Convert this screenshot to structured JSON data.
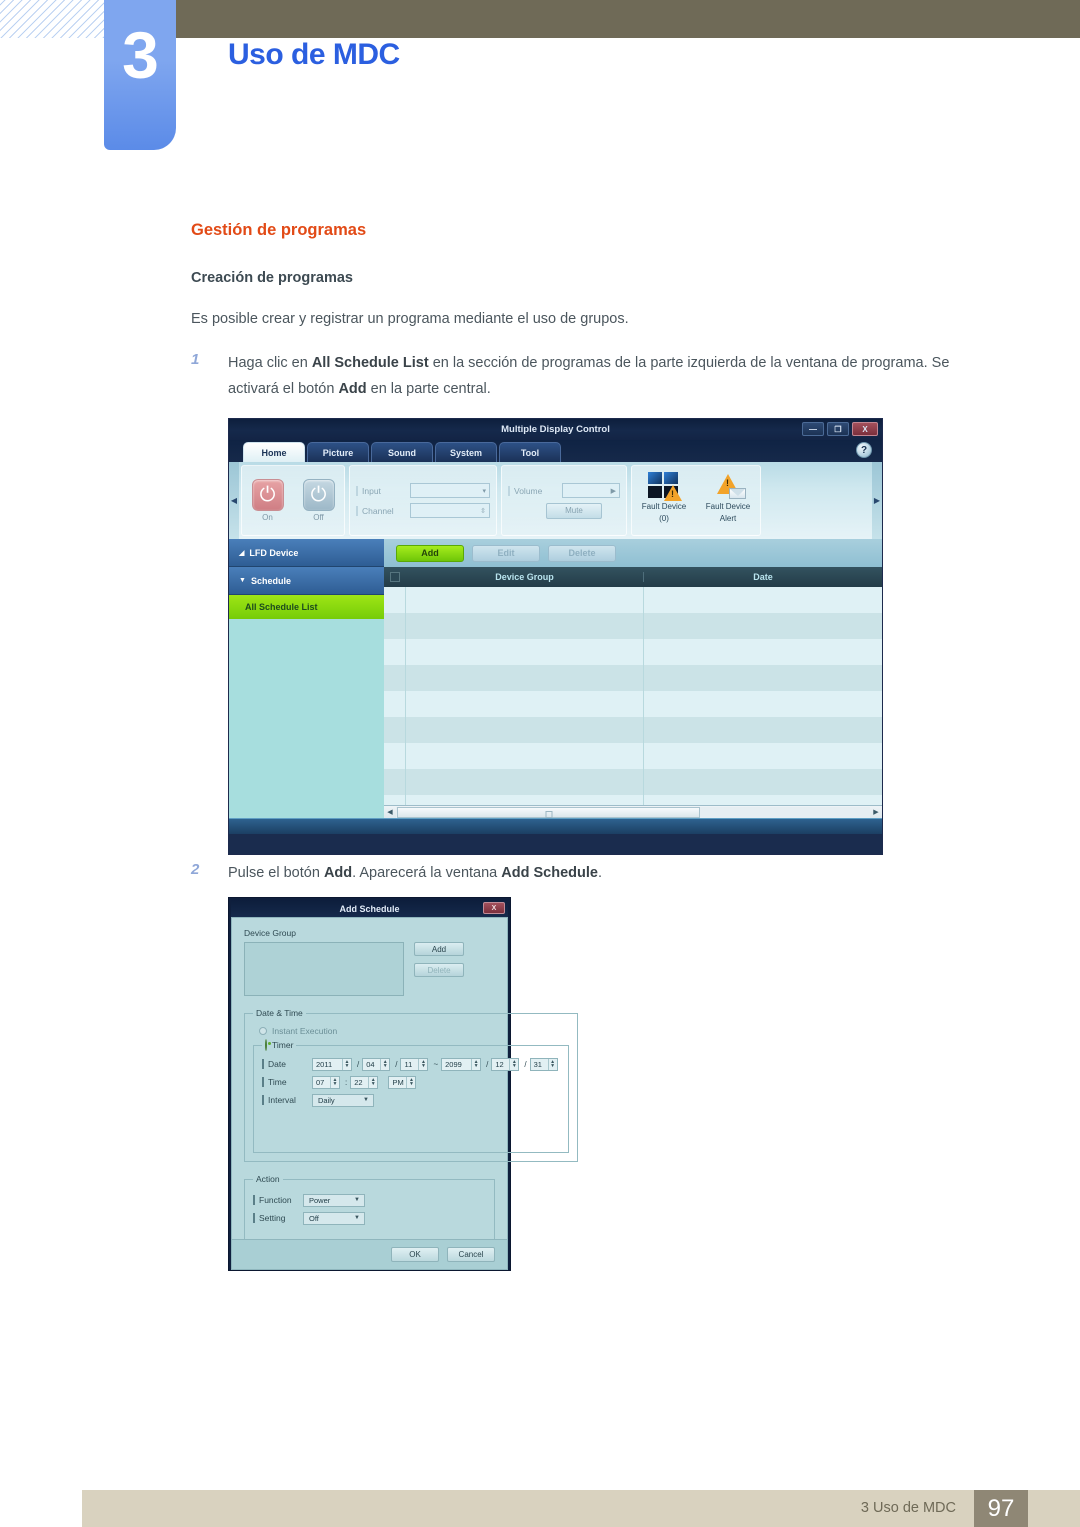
{
  "chapter": {
    "number": "3",
    "title": "Uso de MDC"
  },
  "section": {
    "title": "Gestión de programas",
    "subtitle": "Creación de programas",
    "intro": "Es posible crear y registrar un programa mediante el uso de grupos.",
    "steps": [
      {
        "num": "1",
        "text_1": "Haga clic en ",
        "bold_1": "All Schedule List",
        "text_2": " en la sección de programas de la parte izquierda de la ventana de programa. Se activará el botón ",
        "bold_2": "Add",
        "text_3": " en la parte central."
      },
      {
        "num": "2",
        "text_1": "Pulse el botón ",
        "bold_1": "Add",
        "text_2": ". Aparecerá la ventana ",
        "bold_2": "Add Schedule",
        "text_3": "."
      }
    ]
  },
  "mdc_window": {
    "title": "Multiple Display Control",
    "window_buttons": {
      "minimize": "—",
      "maximize": "❐",
      "close": "X"
    },
    "help_label": "?",
    "tabs": [
      {
        "label": "Home",
        "active": true
      },
      {
        "label": "Picture",
        "active": false
      },
      {
        "label": "Sound",
        "active": false
      },
      {
        "label": "System",
        "active": false
      },
      {
        "label": "Tool",
        "active": false
      }
    ],
    "ribbon": {
      "power": {
        "on_label": "On",
        "off_label": "Off",
        "icon": "power-icon"
      },
      "input_label": "Input",
      "channel_label": "Channel",
      "volume_label": "Volume",
      "mute_label": "Mute",
      "fault_device_label": "Fault Device",
      "fault_device_count": "(0)",
      "fault_alert_label_1": "Fault Device",
      "fault_alert_label_2": "Alert"
    },
    "sidebar": [
      {
        "label": "LFD Device",
        "caret": "◢",
        "type": "group"
      },
      {
        "label": "Schedule",
        "caret": "▼",
        "type": "group"
      },
      {
        "label": "All Schedule List",
        "type": "selected"
      }
    ],
    "buttons": [
      {
        "label": "Add",
        "state": "enabled"
      },
      {
        "label": "Edit",
        "state": "disabled"
      },
      {
        "label": "Delete",
        "state": "disabled"
      }
    ],
    "table": {
      "columns": [
        "",
        "Device Group",
        "Date"
      ],
      "rows": []
    },
    "colors": {
      "accent_green": "#76cc08",
      "title_bar": "#132445",
      "sidebar_blue": "#2e5d94",
      "table_row_light": "#dff1f5",
      "table_row_dark": "#cbe3e7"
    }
  },
  "add_schedule_dialog": {
    "title": "Add Schedule",
    "close_label": "X",
    "device_group": {
      "label": "Device Group",
      "add_label": "Add",
      "delete_label": "Delete"
    },
    "date_time": {
      "legend": "Date & Time",
      "instant_execution": "Instant Execution",
      "timer": "Timer",
      "date_label": "Date",
      "date_start": {
        "year": "2011",
        "month": "04",
        "day": "11"
      },
      "range_sep": "~",
      "date_end": {
        "year": "2099",
        "month": "12",
        "day": "31"
      },
      "time_label": "Time",
      "time": {
        "hour": "07",
        "minute": "22",
        "ampm": "PM"
      },
      "time_sep": ":",
      "interval_label": "Interval",
      "interval_value": "Daily"
    },
    "action": {
      "legend": "Action",
      "function_label": "Function",
      "function_value": "Power",
      "setting_label": "Setting",
      "setting_value": "Off"
    },
    "ok_label": "OK",
    "cancel_label": "Cancel"
  },
  "footer": {
    "text": "3 Uso de MDC",
    "page": "97"
  }
}
